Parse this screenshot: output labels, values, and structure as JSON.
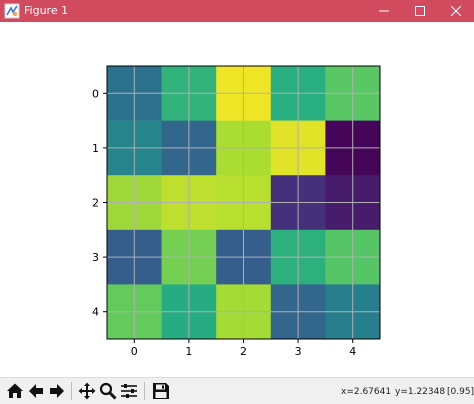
{
  "window": {
    "title": "Figure 1",
    "controls": [
      "minimize-icon",
      "maximize-icon",
      "close-icon"
    ]
  },
  "chart_data": {
    "type": "heatmap",
    "colormap": "viridis",
    "x_ticks": [
      "0",
      "1",
      "2",
      "3",
      "4"
    ],
    "y_ticks": [
      "0",
      "1",
      "2",
      "3",
      "4"
    ],
    "grid": true,
    "values": [
      [
        0.38,
        0.65,
        0.98,
        0.63,
        0.74
      ],
      [
        0.45,
        0.33,
        0.88,
        0.96,
        0.02
      ],
      [
        0.86,
        0.91,
        0.9,
        0.16,
        0.1
      ],
      [
        0.3,
        0.79,
        0.3,
        0.64,
        0.73
      ],
      [
        0.76,
        0.62,
        0.87,
        0.33,
        0.43
      ]
    ]
  },
  "toolbar": {
    "buttons": [
      "home-icon",
      "back-icon",
      "forward-icon",
      "pan-icon",
      "zoom-icon",
      "configure-subplots-icon",
      "save-icon"
    ],
    "x_readout": "x=2.67641",
    "y_readout": "y=1.22348",
    "value_readout": "[0.95]"
  },
  "colors": {
    "titlebar": "#d14a5e",
    "toolbar": "#f0f0f0"
  }
}
